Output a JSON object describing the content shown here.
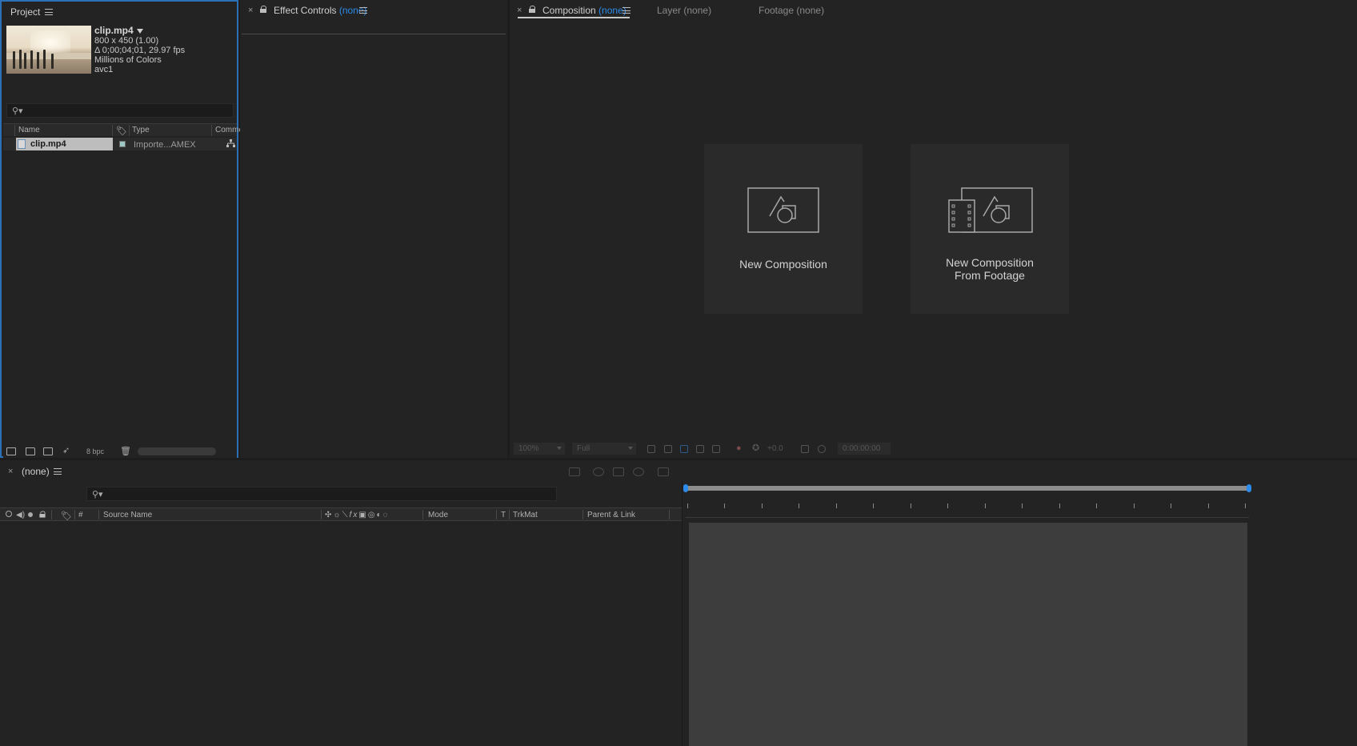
{
  "project": {
    "tab": "Project",
    "file": {
      "name": "clip.mp4",
      "dimensions": "800 x 450 (1.00)",
      "duration_fps": "Δ 0;00;04;01, 29.97 fps",
      "color": "Millions of Colors",
      "codec": "avc1"
    },
    "search_placeholder": "",
    "columns": {
      "name": "Name",
      "type": "Type",
      "comment": "Comme"
    },
    "items": [
      {
        "name": "clip.mp4",
        "type": "Importe...AMEX"
      }
    ],
    "bpc": "8 bpc"
  },
  "effect_controls": {
    "tab": "Effect Controls",
    "target": "(none)"
  },
  "composition": {
    "tab": "Composition",
    "target": "(none)",
    "layer_tab": "Layer",
    "layer_target": "(none)",
    "footage_tab": "Footage",
    "footage_target": "(none)",
    "cards": [
      {
        "label": "New Composition"
      },
      {
        "label": "New Composition\nFrom Footage"
      }
    ],
    "toolbar": {
      "zoom": "100%",
      "resolution": "Full",
      "exposure": "+0.0",
      "timecode": "0:00:00:00"
    }
  },
  "timeline": {
    "tab": "(none)",
    "columns": {
      "number": "#",
      "source_name": "Source Name",
      "mode": "Mode",
      "t": "T",
      "trkmat": "TrkMat",
      "parent": "Parent & Link"
    }
  },
  "colors": {
    "accent": "#2d8ceb",
    "panel": "#232323",
    "selection": "#bdbdbd"
  }
}
